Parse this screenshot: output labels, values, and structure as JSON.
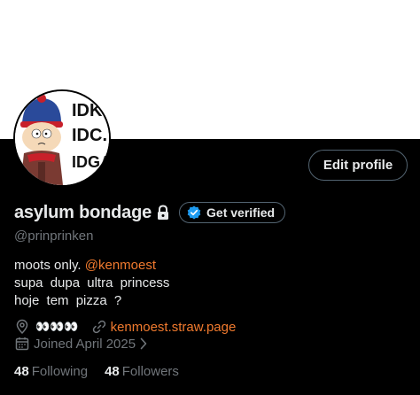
{
  "profile": {
    "display_name": "asylum bondage",
    "handle": "@prinprinken",
    "bio_prefix": "moots only. ",
    "bio_mention": "@kenmoest",
    "bio_line2": "supa dupa ultra princess",
    "bio_line3": "hoje tem pizza ?",
    "location": "👀👀👀",
    "website": "kenmoest.straw.page",
    "joined": "Joined April 2025",
    "avatar_text": [
      "IDK.",
      "IDC.",
      "IDGAF"
    ]
  },
  "buttons": {
    "edit_profile": "Edit profile",
    "get_verified": "Get verified"
  },
  "stats": {
    "following_count": "48",
    "following_label": "Following",
    "followers_count": "48",
    "followers_label": "Followers"
  },
  "colors": {
    "background": "#000000",
    "banner": "#ffffff",
    "accent_link": "#f07a2e",
    "muted_text": "#71767b",
    "verified_blue": "#1d9bf0"
  },
  "icons": [
    "lock-icon",
    "verified-badge-icon",
    "location-pin-icon",
    "link-icon",
    "calendar-icon",
    "chevron-right-icon"
  ]
}
